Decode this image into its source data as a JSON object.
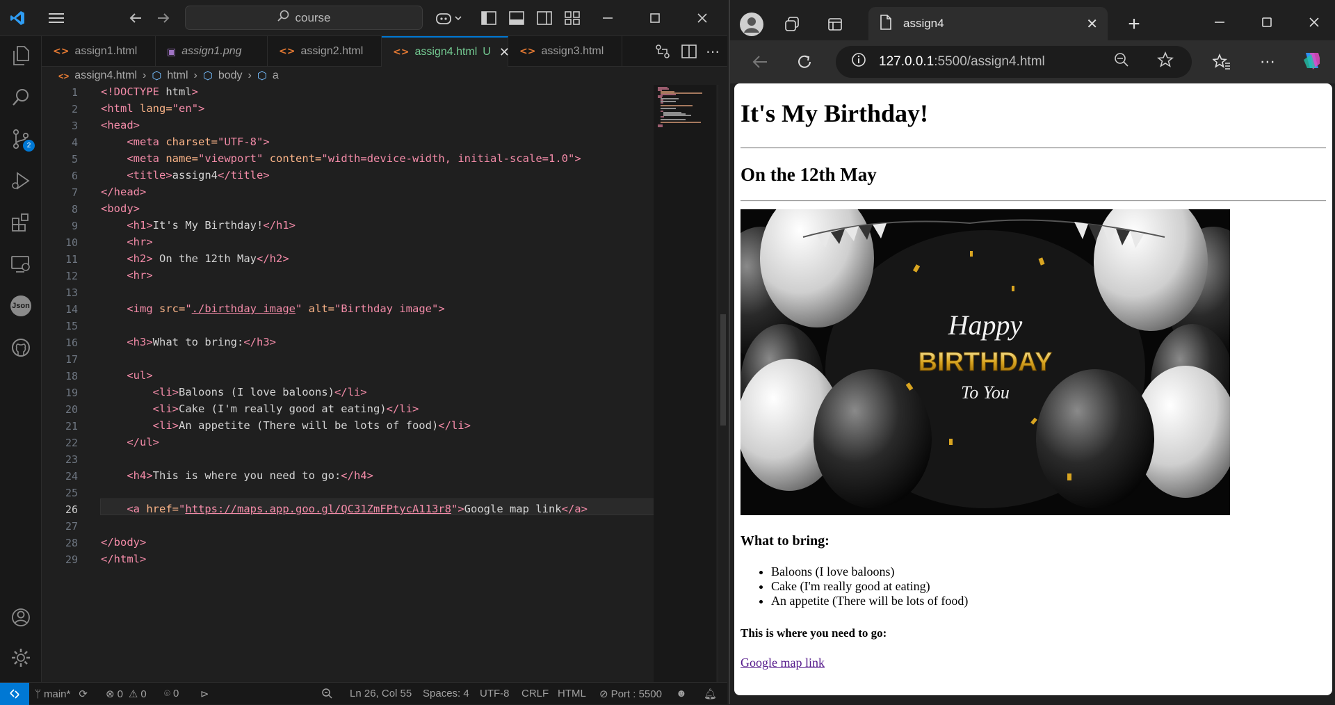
{
  "vscode": {
    "search_label": "course",
    "tabs": [
      {
        "label": "assign1.html",
        "italic": false
      },
      {
        "label": "assign1.png",
        "italic": true
      },
      {
        "label": "assign2.html",
        "italic": false
      },
      {
        "label": "assign4.html",
        "status": "U",
        "active": true
      },
      {
        "label": "assign3.html",
        "italic": false
      }
    ],
    "breadcrumb": [
      "assign4.html",
      "html",
      "body",
      "a"
    ],
    "source_control_badge": "2",
    "json_label": "Json",
    "line_numbers": [
      "1",
      "2",
      "3",
      "4",
      "5",
      "6",
      "7",
      "8",
      "9",
      "10",
      "11",
      "12",
      "13",
      "14",
      "15",
      "16",
      "17",
      "18",
      "19",
      "20",
      "21",
      "22",
      "23",
      "24",
      "25",
      "26",
      "27",
      "28",
      "29"
    ],
    "current_line": 26,
    "code_lines": [
      "<!DOCTYPE html>",
      "<html lang=\"en\">",
      "<head>",
      "    <meta charset=\"UTF-8\">",
      "    <meta name=\"viewport\" content=\"width=device-width, initial-scale=1.0\">",
      "    <title>assign4</title>",
      "</head>",
      "<body>",
      "    <h1>It's My Birthday!</h1>",
      "    <hr>",
      "    <h2> On the 12th May</h2>",
      "    <hr>",
      "",
      "    <img src=\"./birthday image\" alt=\"Birthday image\">",
      "",
      "    <h3>What to bring:</h3>",
      "",
      "    <ul>",
      "        <li>Baloons (I love baloons)</li>",
      "        <li>Cake (I'm really good at eating)</li>",
      "        <li>An appetite (There will be lots of food)</li>",
      "    </ul>",
      "",
      "    <h4>This is where you need to go:</h4>",
      "",
      "    <a href=\"https://maps.app.goo.gl/QC31ZmFPtycA113r8\">Google map link</a>",
      "",
      "</body>",
      "</html>"
    ],
    "status": {
      "branch": "main*",
      "errors": "0",
      "warnings": "0",
      "ports": "0",
      "position": "Ln 26, Col 55",
      "spaces": "Spaces: 4",
      "encoding": "UTF-8",
      "eol": "CRLF",
      "language": "HTML",
      "port": "Port : 5500"
    },
    "colors": {
      "tag": "#f38ba8",
      "attr": "#fab387",
      "string": "#f38ba8",
      "accent": "#0078d4",
      "modified": "#73c991"
    }
  },
  "browser": {
    "tab_title": "assign4",
    "url_host": "127.0.0.1",
    "url_rest": ":5500/assign4.html",
    "page": {
      "h1": "It's My Birthday!",
      "h2": "On the 12th May",
      "image_text": {
        "happy": "Happy",
        "birthday": "BIRTHDAY",
        "to_you": "To You"
      },
      "h3": "What to bring:",
      "items": [
        "Baloons (I love baloons)",
        "Cake (I'm really good at eating)",
        "An appetite (There will be lots of food)"
      ],
      "h4": "This is where you need to go:",
      "link": "Google map link"
    }
  }
}
